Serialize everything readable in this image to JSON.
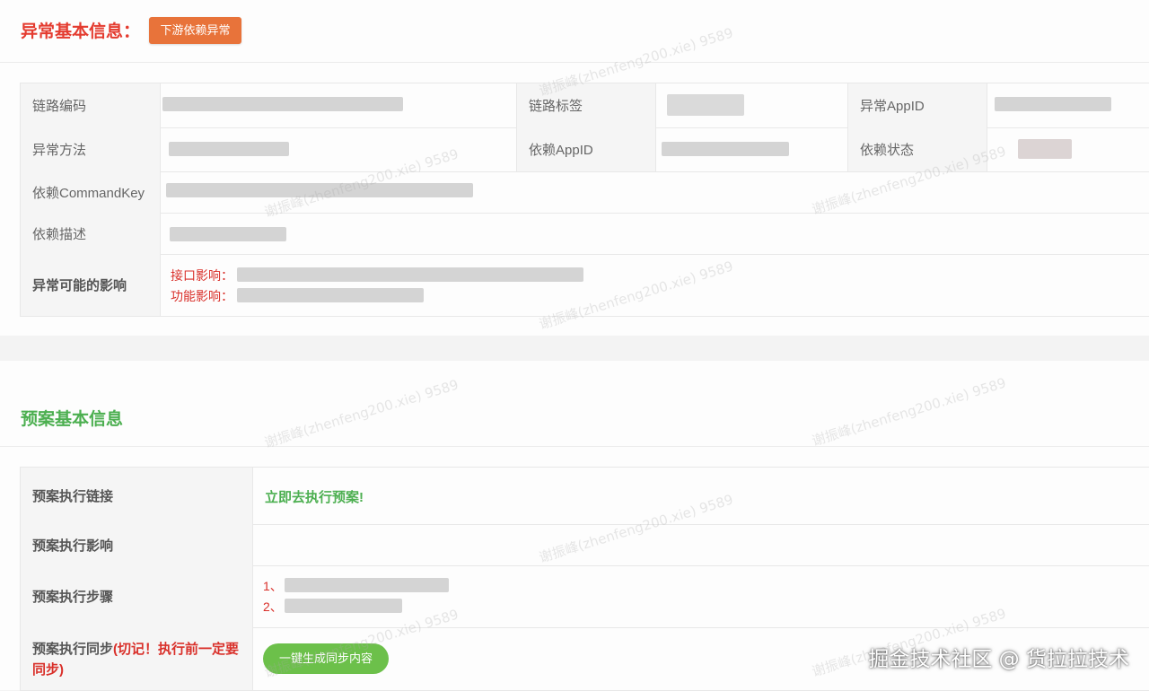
{
  "anomaly": {
    "title": "异常基本信息：",
    "downstream_button": "下游依赖异常",
    "labels": {
      "chain_code": "链路编码",
      "chain_tag": "链路标签",
      "anomaly_appid": "异常AppID",
      "anomaly_method": "异常方法",
      "dep_appid": "依赖AppID",
      "dep_status": "依赖状态",
      "dep_command_key": "依赖CommandKey",
      "dep_desc": "依赖描述",
      "possible_impact": "异常可能的影响"
    },
    "impact": {
      "api_label": "接口影响：",
      "feature_label": "功能影响："
    }
  },
  "plan": {
    "title": "预案基本信息",
    "labels": {
      "exec_link": "预案执行链接",
      "exec_impact": "预案执行影响",
      "exec_steps": "预案执行步骤",
      "exec_sync_prefix": "预案执行同步",
      "exec_sync_warning_line1": "(切记！执行前一定要",
      "exec_sync_warning_line2": "同步)"
    },
    "exec_link_text": "立即去执行预案!",
    "steps": [
      "1、",
      "2、"
    ],
    "sync_button": "一键生成同步内容"
  },
  "watermark": "谢振峰(zhenfeng200.xie) 9589",
  "corner_watermark": "掘金技术社区 @ 货拉拉技术",
  "colors": {
    "anomaly_title": "#e43b2f",
    "plan_title": "#4caf50",
    "orange_button": "#e8733a",
    "green_button": "#6cc04a",
    "red_text": "#d9302a"
  }
}
